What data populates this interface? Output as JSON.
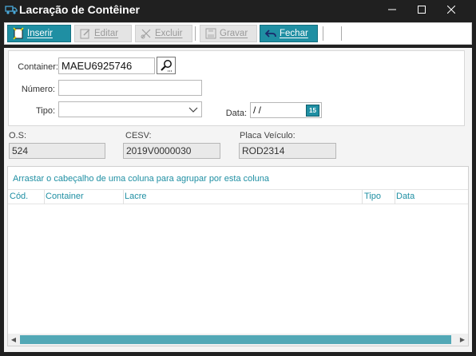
{
  "window": {
    "title": "Lacração de Contêiner",
    "icon": "truck-icon",
    "controls": [
      "minimize-icon",
      "maximize-icon",
      "close-icon"
    ]
  },
  "toolbar": {
    "buttons": [
      {
        "label": "Inserir",
        "icon": "insert-doc-icon",
        "enabled": true
      },
      {
        "label": "Editar",
        "icon": "edit-icon",
        "enabled": false
      },
      {
        "label": "Excluir",
        "icon": "scissors-icon",
        "enabled": false
      },
      {
        "label": "Gravar",
        "icon": "save-icon",
        "enabled": false
      },
      {
        "label": "Fechar",
        "icon": "undo-arrow-icon",
        "enabled": true
      }
    ]
  },
  "form": {
    "container_label": "Container:",
    "container_value": "MAEU6925746",
    "numero_label": "Número:",
    "numero_value": "",
    "tipo_label": "Tipo:",
    "tipo_value": "",
    "data_label": "Data:",
    "data_value": " / /",
    "calendar_label": "15"
  },
  "info": {
    "os_label": "O.S:",
    "os_value": "524",
    "cesv_label": "CESV:",
    "cesv_value": "2019V0000030",
    "placa_label": "Placa Veículo:",
    "placa_value": "ROD2314"
  },
  "grid": {
    "group_hint": "Arrastar o cabeçalho de uma coluna para agrupar por esta coluna",
    "columns": [
      "Cód.",
      "Container",
      "Lacre",
      "Tipo",
      "Data"
    ],
    "rows": []
  },
  "colors": {
    "accent": "#1f8fa3",
    "titlebar": "#202020"
  }
}
